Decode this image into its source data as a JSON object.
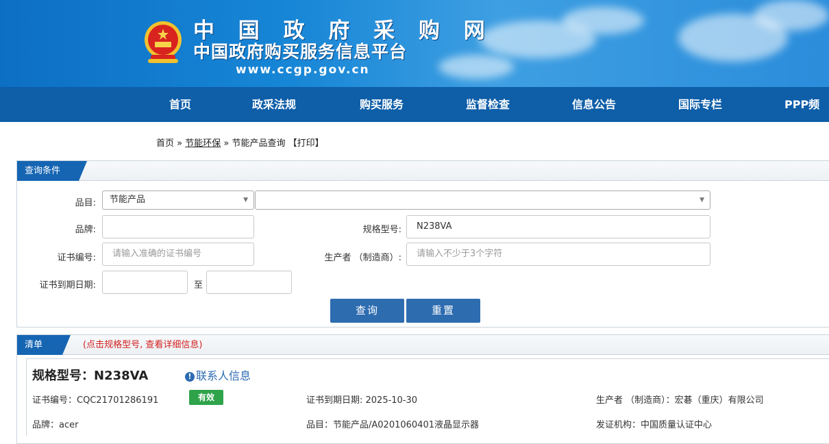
{
  "header": {
    "title": "中 国 政 府 采 购 网",
    "subtitle": "中国政府购买服务信息平台",
    "url": "www.ccgp.gov.cn"
  },
  "nav": [
    "首页",
    "政采法规",
    "购买服务",
    "监督检查",
    "信息公告",
    "国际专栏",
    "PPP频道"
  ],
  "breadcrumb": {
    "home": "首页",
    "sep1": " » ",
    "section": "节能环保",
    "sep2": " » ",
    "current": "节能产品查询",
    "print": "【打印】"
  },
  "query": {
    "tab": "查询条件",
    "category_label": "品目:",
    "category_value": "节能产品",
    "subcategory_value": "",
    "brand_label": "品牌:",
    "brand_value": "",
    "model_label": "规格型号:",
    "model_value": "N238VA",
    "cert_no_label": "证书编号:",
    "cert_no_placeholder": "请输入准确的证书编号",
    "maker_label": "生产者 （制造商）:",
    "maker_placeholder": "请输入不少于3个字符",
    "expiry_label": "证书到期日期:",
    "to_label": "至",
    "search_button": "查询",
    "reset_button": "重置"
  },
  "list": {
    "tab": "清单",
    "note": "(点击规格型号, 查看详细信息)",
    "item": {
      "model_title": "规格型号：N238VA",
      "contact": "联系人信息",
      "cert_no": "证书编号：CQC21701286191",
      "status": "有效",
      "expiry": "证书到期日期: 2025-10-30",
      "maker": "生产者 （制造商）：宏碁（重庆）有限公司",
      "brand": "品牌：acer",
      "category": "品目：节能产品/A0201060401液晶显示器",
      "issuer": "发证机构：中国质量认证中心"
    }
  },
  "colors": {
    "nav_bg": "#0e5ea8",
    "tab_bg": "#1565b3",
    "button_bg": "#2e6cb0",
    "badge_bg": "#2ea34a",
    "note": "#d11f1f"
  }
}
